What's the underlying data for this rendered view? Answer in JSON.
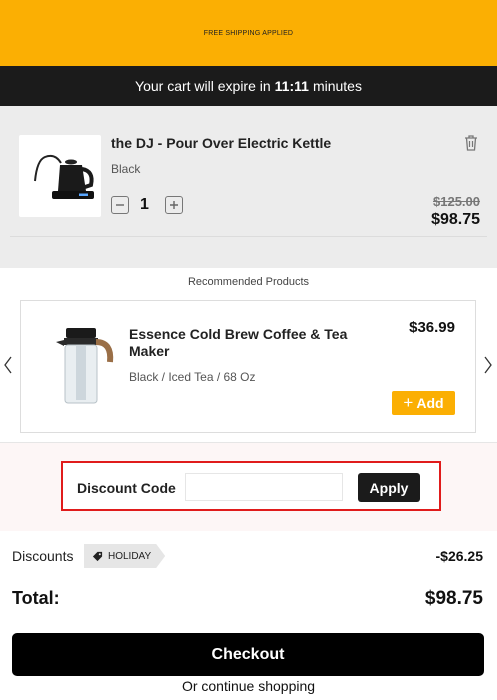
{
  "promo": {
    "text": "FREE SHIPPING APPLIED"
  },
  "timer": {
    "prefix": "Your cart will expire in",
    "time": "11:11",
    "suffix": "minutes"
  },
  "cart_item": {
    "image": "electric-kettle-image",
    "title": "the DJ - Pour Over Electric Kettle",
    "variant": "Black",
    "quantity": "1",
    "minus_icon": "minus-icon",
    "plus_icon": "plus-icon",
    "delete_icon": "trash-icon",
    "original_price": "$125.00",
    "price": "$98.75"
  },
  "recommended": {
    "heading": "Recommended Products",
    "product": {
      "image": "cold-brew-pitcher-image",
      "name": "Essence Cold Brew Coffee & Tea Maker",
      "variant": "Black / Iced Tea / 68 Oz",
      "price": "$36.99",
      "add_label": "Add",
      "add_icon": "plus-icon"
    },
    "prev_icon": "chevron-left-icon",
    "next_icon": "chevron-right-icon"
  },
  "discount": {
    "label": "Discount Code",
    "input_value": "",
    "apply_label": "Apply"
  },
  "summary": {
    "discounts_label": "Discounts",
    "code": "HOLIDAY",
    "code_icon": "tag-icon",
    "discount_amount": "-$26.25",
    "total_label": "Total:",
    "total_amount": "$98.75"
  },
  "actions": {
    "checkout_label": "Checkout",
    "continue_label": "Or continue shopping"
  },
  "colors": {
    "accent": "#fbaf03",
    "dark": "#1b1b1b",
    "highlight_border": "#e01b1b",
    "cart_bg": "#ececec"
  }
}
